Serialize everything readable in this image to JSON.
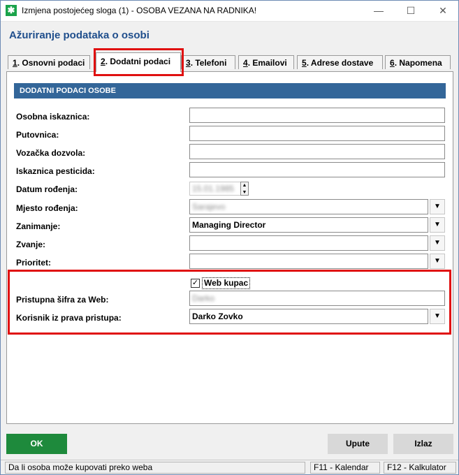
{
  "window": {
    "title": "Izmjena postojećeg sloga (1) - OSOBA VEZANA NA RADNIKA!",
    "minimize": "—",
    "maximize": "☐",
    "close": "✕"
  },
  "header": {
    "title": "Ažuriranje podataka o osobi"
  },
  "tabs": [
    {
      "key": "1",
      "label": ". Osnovni podaci"
    },
    {
      "key": "2",
      "label": ". Dodatni podaci",
      "active": true
    },
    {
      "key": "3",
      "label": ". Telefoni"
    },
    {
      "key": "4",
      "label": ". Emailovi"
    },
    {
      "key": "5",
      "label": ". Adrese dostave"
    },
    {
      "key": "6",
      "label": ". Napomena"
    }
  ],
  "section": {
    "title": "DODATNI PODACI OSOBE"
  },
  "fields": {
    "osobna_iskaznica": {
      "label": "Osobna iskaznica:",
      "value": ""
    },
    "putovnica": {
      "label": "Putovnica:",
      "value": ""
    },
    "vozacka": {
      "label": "Vozačka dozvola:",
      "value": ""
    },
    "iskaznica_pesticida": {
      "label": "Iskaznica pesticida:",
      "value": ""
    },
    "datum_rodjenja": {
      "label": "Datum rođenja:",
      "value": "15.01.1985"
    },
    "mjesto_rodjenja": {
      "label": "Mjesto rođenja:",
      "value": "Sarajevo"
    },
    "zanimanje": {
      "label": "Zanimanje:",
      "value": "Managing Director"
    },
    "zvanje": {
      "label": "Zvanje:",
      "value": ""
    },
    "prioritet": {
      "label": "Prioritet:",
      "value": ""
    },
    "web_kupac": {
      "label": "Web kupac",
      "checked": true
    },
    "pristupna_sifra": {
      "label": "Pristupna šifra za Web:",
      "value": "Darko"
    },
    "korisnik_prava": {
      "label": "Korisnik iz prava pristupa:",
      "value": "Darko Zovko"
    }
  },
  "buttons": {
    "ok": "OK",
    "upute": "Upute",
    "izlaz": "Izlaz"
  },
  "statusbar": {
    "message": "Da li osoba može kupovati preko weba",
    "f11": "F11 - Kalendar",
    "f12": "F12 - Kalkulator"
  },
  "colors": {
    "accent": "#336699",
    "ok_button": "#1e8a3c",
    "highlight": "#e01010",
    "header_text": "#1f4e8c"
  },
  "icons": {
    "app": "app-green-icon",
    "dropdown": "dropdown-arrow-icon",
    "spinner": "spinner-icon",
    "checkbox": "checkmark-icon"
  }
}
